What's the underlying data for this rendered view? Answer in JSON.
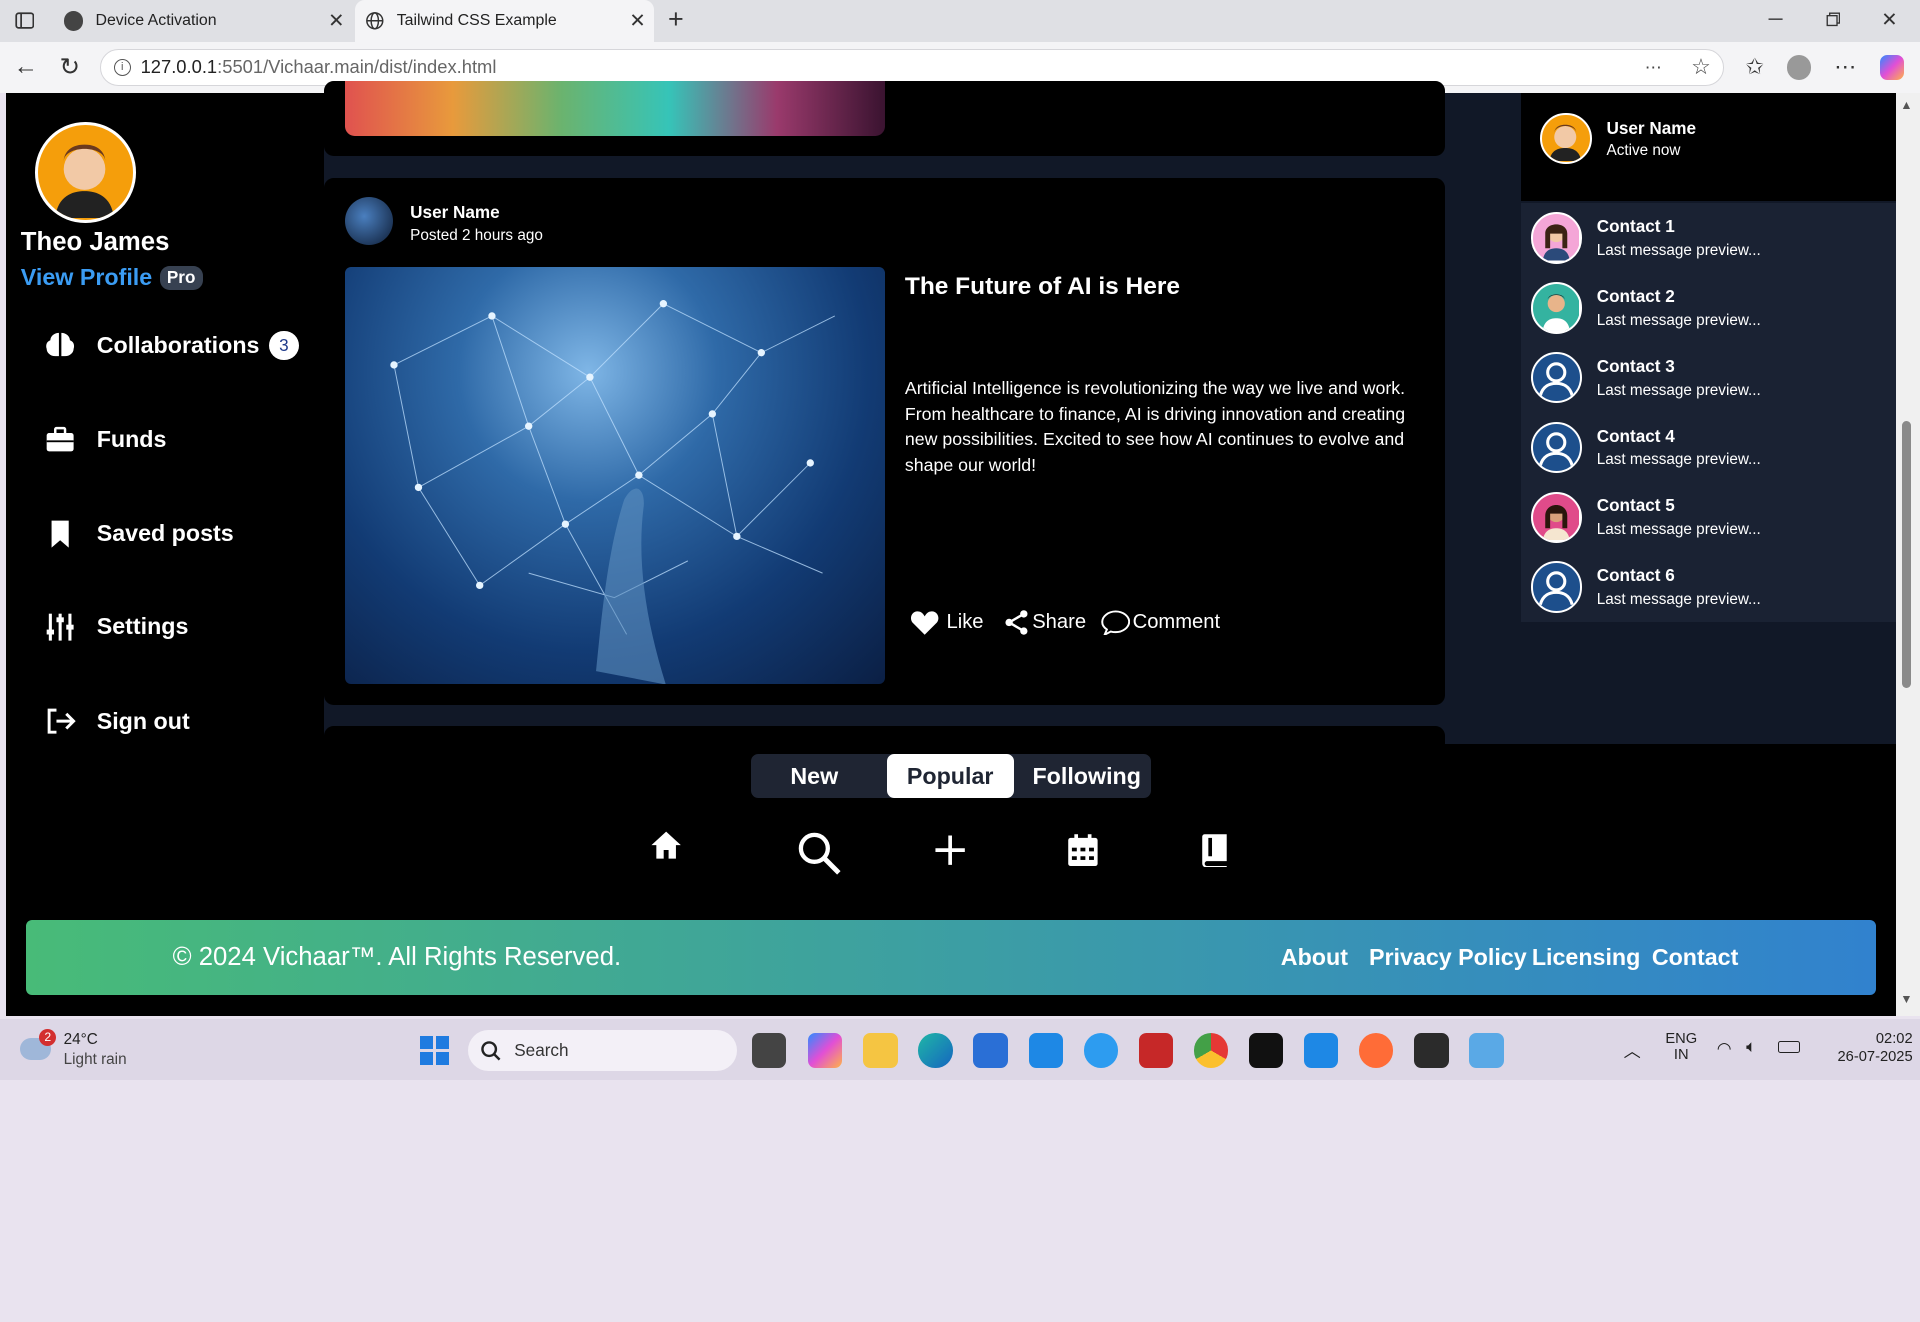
{
  "browser": {
    "tabs": [
      {
        "title": "Device Activation",
        "active": false
      },
      {
        "title": "Tailwind CSS Example",
        "active": true
      }
    ],
    "url_host": "127.0.0.1",
    "url_rest": ":5501/Vichaar.main/dist/index.html"
  },
  "profile": {
    "name": "Theo James",
    "view_profile": "View Profile",
    "badge": "Pro"
  },
  "nav": [
    {
      "label": "Collaborations",
      "icon": "brain-icon",
      "count": "3"
    },
    {
      "label": "Funds",
      "icon": "briefcase-icon"
    },
    {
      "label": "Saved posts",
      "icon": "bookmark-icon"
    },
    {
      "label": "Settings",
      "icon": "sliders-icon"
    },
    {
      "label": "Sign out",
      "icon": "sign-out-icon"
    }
  ],
  "post": {
    "user": "User Name",
    "time": "Posted 2 hours ago",
    "title": "The Future of AI is Here",
    "body": "Artificial Intelligence is revolutionizing the way we live and work. From healthcare to finance, AI is driving innovation and creating new possibilities. Excited to see how AI continues to evolve and shape our world!",
    "actions": {
      "like": "Like",
      "share": "Share",
      "comment": "Comment"
    }
  },
  "chat": {
    "user": "User Name",
    "status": "Active now",
    "contacts": [
      {
        "name": "Contact 1",
        "preview": "Last message preview..."
      },
      {
        "name": "Contact 2",
        "preview": "Last message preview..."
      },
      {
        "name": "Contact 3",
        "preview": "Last message preview..."
      },
      {
        "name": "Contact 4",
        "preview": "Last message preview..."
      },
      {
        "name": "Contact 5",
        "preview": "Last message preview..."
      },
      {
        "name": "Contact 6",
        "preview": "Last message preview..."
      }
    ]
  },
  "feed_tabs": [
    "New",
    "Popular",
    "Following"
  ],
  "active_feed_tab": "Popular",
  "bottom_nav": [
    "home-icon",
    "search-icon",
    "plus-icon",
    "calendar-icon",
    "book-icon"
  ],
  "footer": {
    "copyright": "© 2024 Vichaar™. All Rights Reserved.",
    "links": [
      "About",
      "Privacy Policy",
      "Licensing",
      "Contact"
    ],
    "gradient": [
      "#48bb78",
      "#3182ce"
    ]
  },
  "taskbar": {
    "weather_temp": "24°C",
    "weather_desc": "Light rain",
    "weather_badge": "2",
    "search": "Search",
    "lang1": "ENG",
    "lang2": "IN",
    "time": "02:02",
    "date": "26-07-2025"
  }
}
